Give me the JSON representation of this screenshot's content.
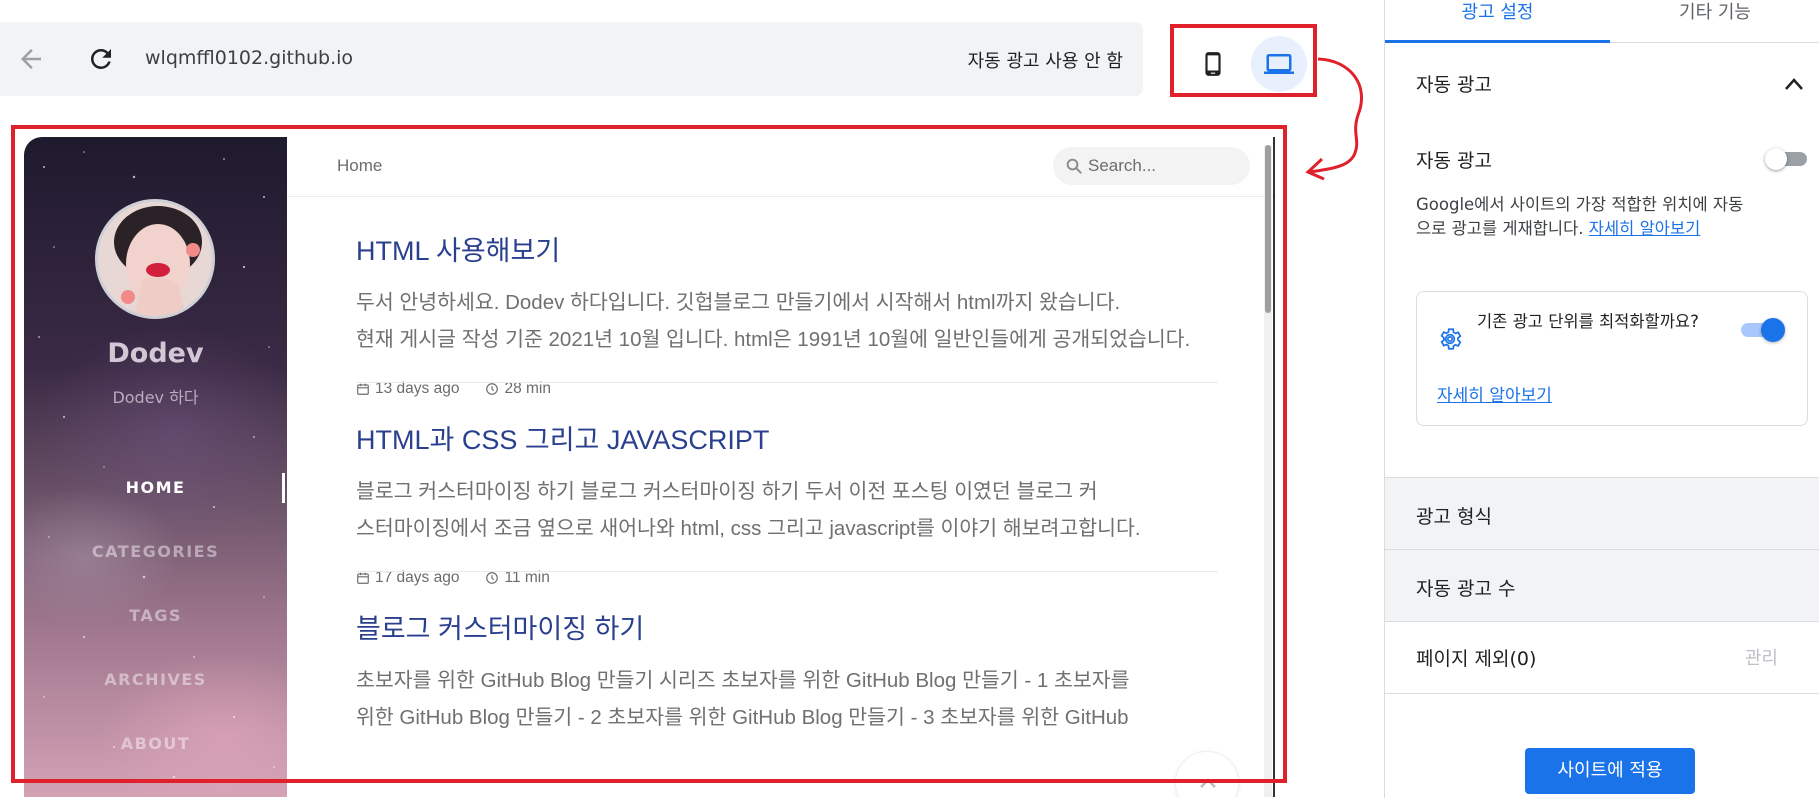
{
  "toolbar": {
    "url": "wlqmffl0102.github.io",
    "status": "자동 광고 사용 안 함",
    "device_phone_icon": "smartphone-icon",
    "device_laptop_icon": "laptop-icon"
  },
  "blog": {
    "site_title": "Dodev",
    "site_subtitle": "Dodev 하다",
    "nav": [
      "HOME",
      "CATEGORIES",
      "TAGS",
      "ARCHIVES",
      "ABOUT"
    ],
    "active_nav": "HOME",
    "breadcrumb": "Home",
    "search_placeholder": "Search...",
    "posts": [
      {
        "title": "HTML 사용해보기",
        "line1": "두서 안녕하세요. Dodev 하다입니다. 깃헙블로그 만들기에서 시작해서 html까지 왔습니다.",
        "line2": "현재 게시글 작성 기준 2021년 10월 입니다. html은 1991년 10월에 일반인들에게 공개되었습니다.",
        "date": "13 days ago",
        "read": "28 min"
      },
      {
        "title": "HTML과 CSS 그리고 JAVASCRIPT",
        "line1": "블로그 커스터마이징 하기 블로그 커스터마이징 하기 두서 이전 포스팅 이였던 블로그 커",
        "line2": "스터마이징에서 조금 옆으로 새어나와 html, css 그리고 javascript를 이야기 해보려고합니다.",
        "date": "17 days ago",
        "read": "11 min"
      },
      {
        "title": "블로그 커스터마이징 하기",
        "line1": "초보자를 위한 GitHub Blog 만들기 시리즈 초보자를 위한 GitHub Blog 만들기 - 1 초보자를",
        "line2": "위한 GitHub Blog 만들기 - 2 초보자를 위한 GitHub Blog 만들기 - 3 초보자를 위한 GitHub",
        "date": "",
        "read": ""
      }
    ]
  },
  "panel": {
    "tabs": [
      "광고 설정",
      "기타 기능"
    ],
    "section_title": "자동 광고",
    "auto_ads_label": "자동 광고",
    "auto_ads_on": false,
    "description": "Google에서 사이트의 가장 적합한 위치에 자동으로 광고를 게재합니다.",
    "learn_more": "자세히 알아보기",
    "optimize_text": "기존 광고 단위를 최적화할까요?",
    "optimize_on": true,
    "optimize_link": "자세히 알아보기",
    "ad_format": "광고 형식",
    "ad_count": "자동 광고 수",
    "page_exclusions_label": "페이지 제외",
    "page_exclusions_count": "(0)",
    "manage": "관리",
    "apply_button": "사이트에 적용"
  },
  "colors": {
    "accent": "#1a73e8",
    "annotation_red": "#e0212c",
    "post_title": "#2a408e"
  }
}
